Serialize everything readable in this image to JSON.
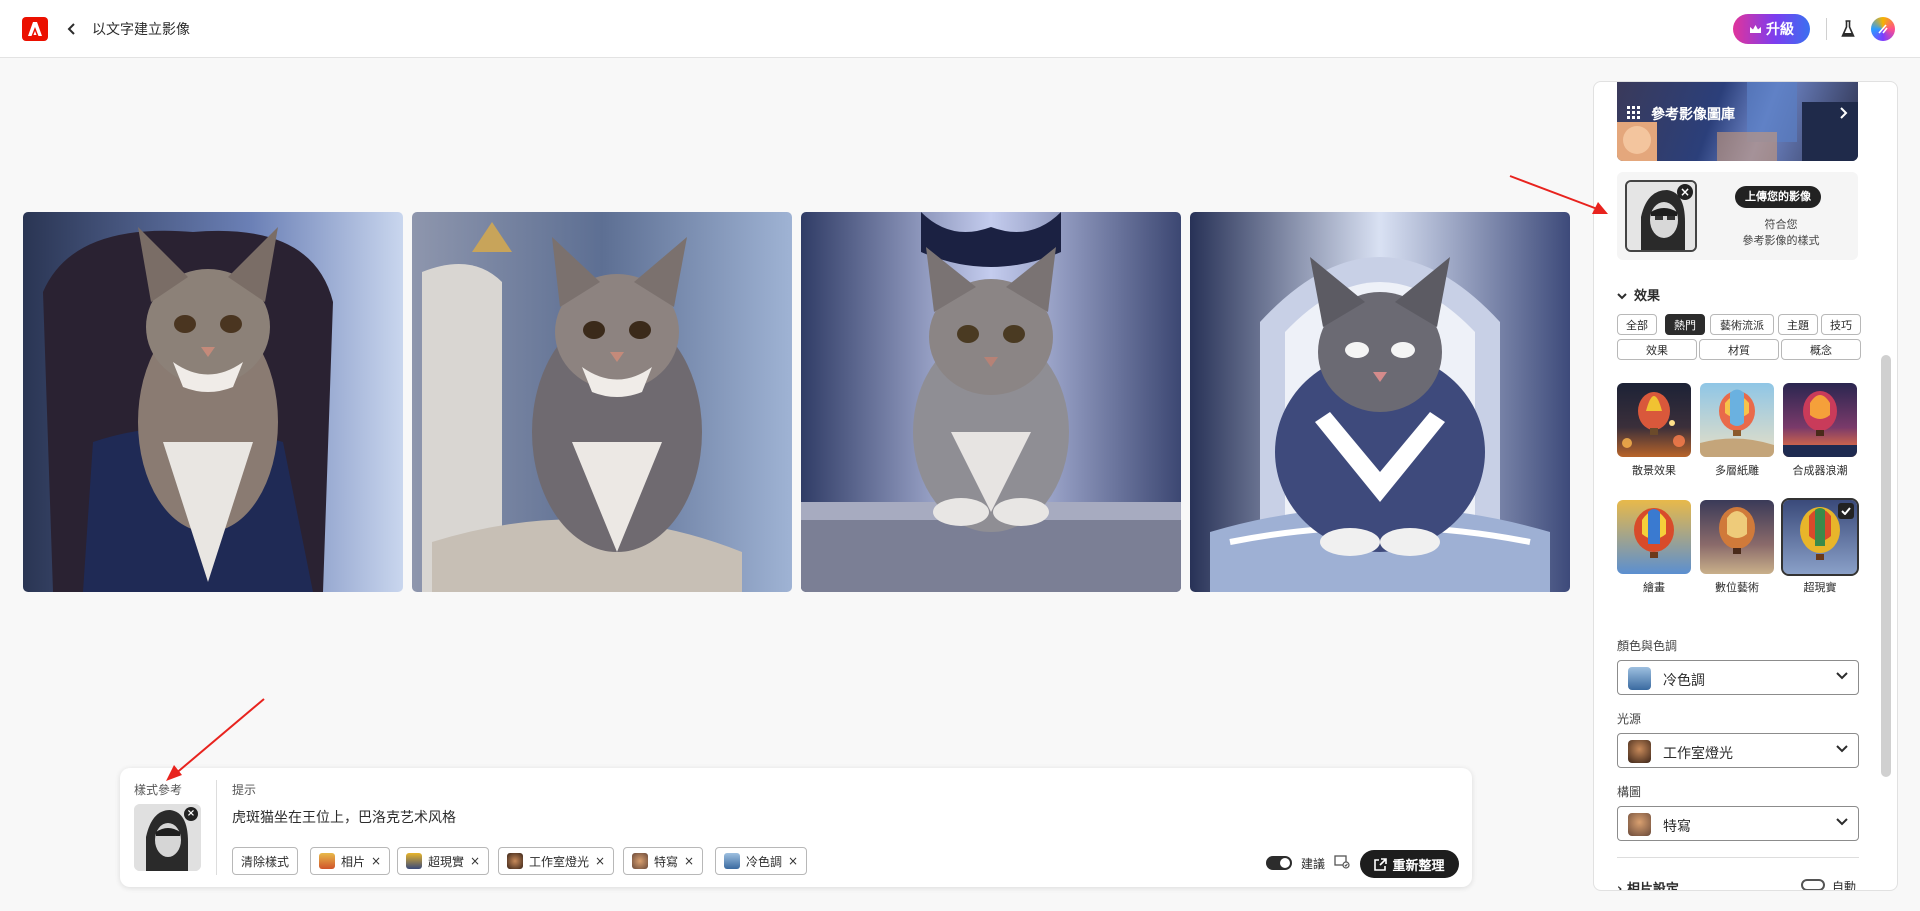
{
  "header": {
    "title": "以文字建立影像",
    "upgrade_label": "升級"
  },
  "results": [
    {
      "name": "result-1"
    },
    {
      "name": "result-2"
    },
    {
      "name": "result-3"
    },
    {
      "name": "result-4"
    }
  ],
  "panel": {
    "gallery_label": "參考影像圖庫",
    "upload_badge": "上傳您的影像",
    "upload_desc_line1": "符合您",
    "upload_desc_line2": "參考影像的樣式",
    "effects_title": "效果",
    "effect_tabs": [
      "全部",
      "熱門",
      "藝術流派",
      "主題",
      "技巧",
      "效果",
      "材質",
      "概念"
    ],
    "active_tab": "熱門",
    "effects": [
      "散景效果",
      "多層紙雕",
      "合成器浪潮",
      "繪畫",
      "數位藝術",
      "超現實"
    ],
    "selected_effect": "超現實",
    "color_label": "顏色與色調",
    "color_value": "冷色調",
    "light_label": "光源",
    "light_value": "工作室燈光",
    "composition_label": "構圖",
    "composition_value": "特寫",
    "photo_settings_label": "相片設定",
    "auto_label": "自動"
  },
  "prompt": {
    "style_ref_label": "樣式參考",
    "prompt_label": "提示",
    "prompt_text": "虎斑猫坐在王位上，巴洛克艺术风格",
    "clear_style_label": "清除樣式",
    "tags": [
      "相片",
      "超現實",
      "工作室燈光",
      "特寫",
      "冷色調"
    ],
    "suggest_label": "建議",
    "regen_label": "重新整理"
  }
}
